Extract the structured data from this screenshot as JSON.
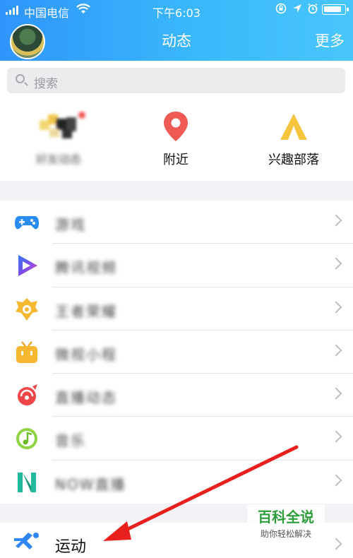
{
  "status_bar": {
    "carrier": "中国电信",
    "time": "下午6:03"
  },
  "header": {
    "title": "动态",
    "more_label": "更多"
  },
  "search": {
    "placeholder": "搜索"
  },
  "quick_actions": [
    {
      "label": "好友动态",
      "icon": "friends-avatar-icon",
      "blurred": true
    },
    {
      "label": "附近",
      "icon": "location-pin-icon",
      "blurred": false
    },
    {
      "label": "兴趣部落",
      "icon": "tent-icon",
      "blurred": false
    }
  ],
  "list_items": [
    {
      "label": "游戏",
      "icon": "gamepad-icon",
      "blurred": true
    },
    {
      "label": "腾讯视频",
      "icon": "video-play-icon",
      "blurred": true
    },
    {
      "label": "王者荣耀",
      "icon": "crown-badge-icon",
      "blurred": true
    },
    {
      "label": "微视小程",
      "icon": "tv-icon",
      "blurred": true
    },
    {
      "label": "直播动态",
      "icon": "broadcast-icon",
      "blurred": true
    },
    {
      "label": "音乐",
      "icon": "music-note-icon",
      "blurred": true
    },
    {
      "label": "NOW直播",
      "icon": "now-logo-icon",
      "blurred": true
    }
  ],
  "sport_item": {
    "label": "运动",
    "icon": "runner-icon"
  },
  "watermark": {
    "title": "百科全说",
    "subtitle": "助你轻松解决"
  },
  "colors": {
    "header_start": "#2f95fb",
    "header_end": "#49c6fb",
    "annotation_arrow": "#e8211e"
  }
}
